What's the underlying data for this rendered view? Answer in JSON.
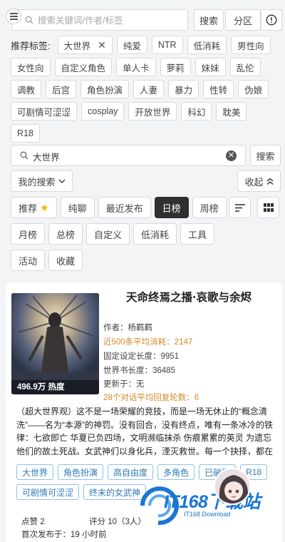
{
  "top": {
    "search_placeholder": "搜索关键词/作者/标签",
    "search_button": "搜索",
    "zone_button": "分区"
  },
  "tags": {
    "label": "推荐标签:",
    "active": "大世界",
    "items": [
      "纯爱",
      "NTR",
      "低消耗",
      "男性向",
      "女性向",
      "自定义角色",
      "单人卡",
      "萝莉",
      "妹妹",
      "乱伦",
      "调教",
      "后宫",
      "角色扮演",
      "人妻",
      "暴力",
      "性转",
      "伪娘",
      "可剧情可涩涩",
      "cosplay",
      "开放世界",
      "科幻",
      "耽美",
      "R18"
    ]
  },
  "search2": {
    "value": "大世界",
    "button": "搜索"
  },
  "my_search": "我的搜索",
  "collapse": "收起",
  "rank": {
    "row1": [
      "推荐",
      "纯聊",
      "最近发布",
      "日榜",
      "周榜"
    ],
    "row2": [
      "月榜",
      "总榜",
      "自定义",
      "低消耗",
      "工具"
    ],
    "row3": [
      "活动",
      "收藏"
    ],
    "selected": "日榜"
  },
  "card": {
    "cover_badge": "496.9万 热度",
    "title": "天命终焉之播·哀歌与余烬",
    "author": "作者：杨羁羁",
    "avg_cost": "近500条平均消耗：2147",
    "fixed_len": "固定设定长度：9951",
    "world_len": "世界书长度：36485",
    "update": "更新于：无",
    "avg_turns": "28个对话平均回复轮数：6",
    "desc": "（超大世界观）这不是一场荣耀的竞技，而是一场无休止的“概念清洗”——名为“本源”的神罚。没有回合，没有终点，唯有一条冰冷的铁律：七欲即亡 华夏已负四场，文明濒临抹杀 伤痕累累的英灵 为遗忘他们的故土死战。女武神们以身化兵，湮灭救世。每一个抉择，都在牺牲未来与牺牲…",
    "tags": [
      "大世界",
      "角色扮演",
      "高自由度",
      "多角色",
      "已破限",
      "R18",
      "可剧情可涩涩",
      "终末的女武神"
    ],
    "likes": "点赞 2",
    "rating": "评分 10（3人）",
    "first_published": "首次发布于：19 小时前"
  },
  "watermark": {
    "brand": "IT168下载站",
    "sub": "IT168 Download"
  },
  "colors": {
    "accent_orange": "#d18b2b",
    "tag_blue": "#2f78b8",
    "selected": "#2f2f2f"
  }
}
